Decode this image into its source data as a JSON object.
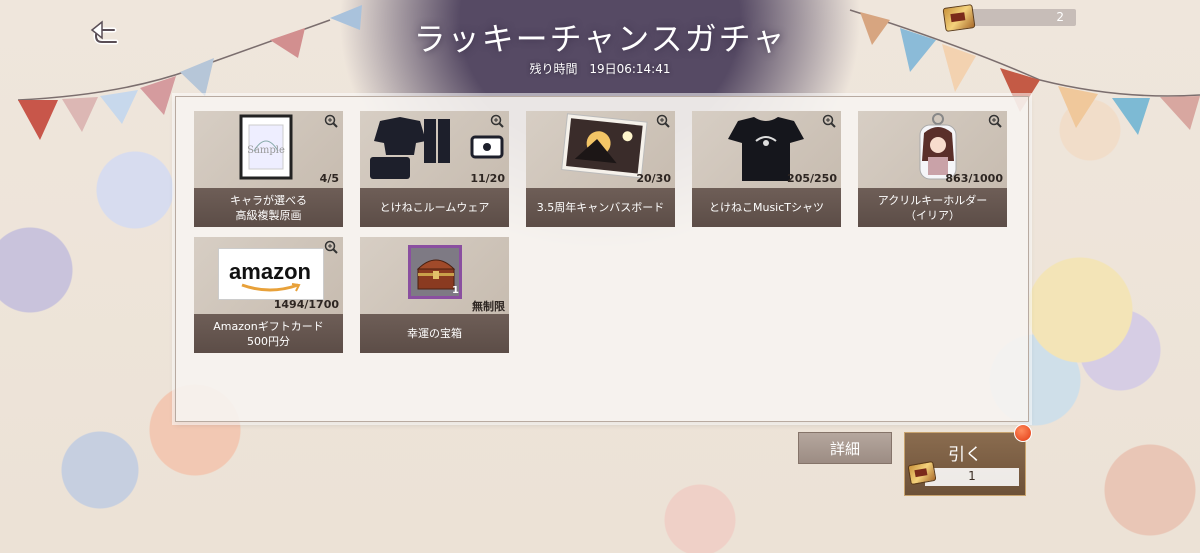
{
  "header": {
    "title": "ラッキーチャンスガチャ",
    "timer_label": "残り時間",
    "timer_value": "19日06:14:41",
    "ticket_count": "2"
  },
  "items": [
    {
      "name": "キャラが選べる\n高級複製原画",
      "stock": "4/5",
      "image": "framed-art-icon"
    },
    {
      "name": "とけねこルームウェア",
      "stock": "11/20",
      "image": "room-wear-icon"
    },
    {
      "name": "3.5周年キャンバスボード",
      "stock": "20/30",
      "image": "canvas-board-icon"
    },
    {
      "name": "とけねこMusicTシャツ",
      "stock": "205/250",
      "image": "tshirt-icon"
    },
    {
      "name": "アクリルキーホルダー\n（イリア）",
      "stock": "863/1000",
      "image": "acrylic-keychain-icon"
    },
    {
      "name": "Amazonギフトカード\n500円分",
      "stock": "1494/1700",
      "image": "amazon-giftcard-icon",
      "image_text": "amazon"
    },
    {
      "name": "幸運の宝箱",
      "stock": "無制限",
      "image": "treasure-chest-icon",
      "badge": "1"
    }
  ],
  "buttons": {
    "detail_label": "詳細",
    "draw_label": "引く",
    "draw_cost": "1"
  }
}
